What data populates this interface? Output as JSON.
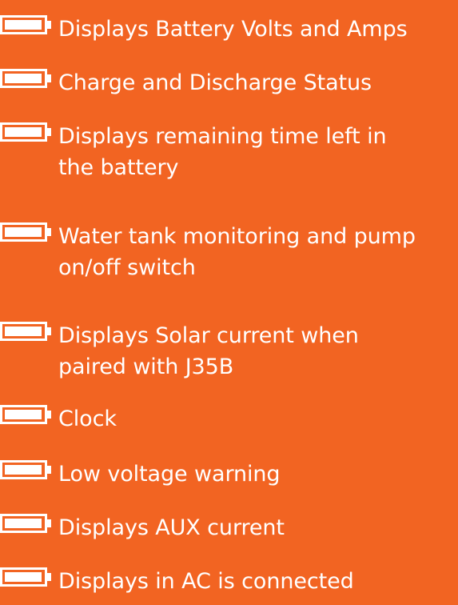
{
  "features": [
    {
      "icon": "battery-icon",
      "lines": [
        "Displays Battery Volts and Amps"
      ]
    },
    {
      "icon": "battery-icon",
      "lines": [
        "Charge and Discharge Status"
      ]
    },
    {
      "icon": "battery-icon",
      "lines": [
        "Displays remaining time left in",
        "the battery"
      ]
    },
    {
      "icon": "battery-icon",
      "lines": [
        "Water tank monitoring and pump",
        "on/off switch"
      ]
    },
    {
      "icon": "battery-icon",
      "lines": [
        "Displays Solar current when",
        "paired with J35B"
      ]
    },
    {
      "icon": "battery-icon",
      "lines": [
        "Clock"
      ]
    },
    {
      "icon": "battery-icon",
      "lines": [
        "Low voltage warning"
      ]
    },
    {
      "icon": "battery-icon",
      "lines": [
        "Displays AUX current"
      ]
    },
    {
      "icon": "battery-icon",
      "lines": [
        "Displays in AC is connected"
      ]
    }
  ],
  "colors": {
    "background": "#f26422",
    "text": "#ffffff",
    "icon": "#ffffff"
  }
}
